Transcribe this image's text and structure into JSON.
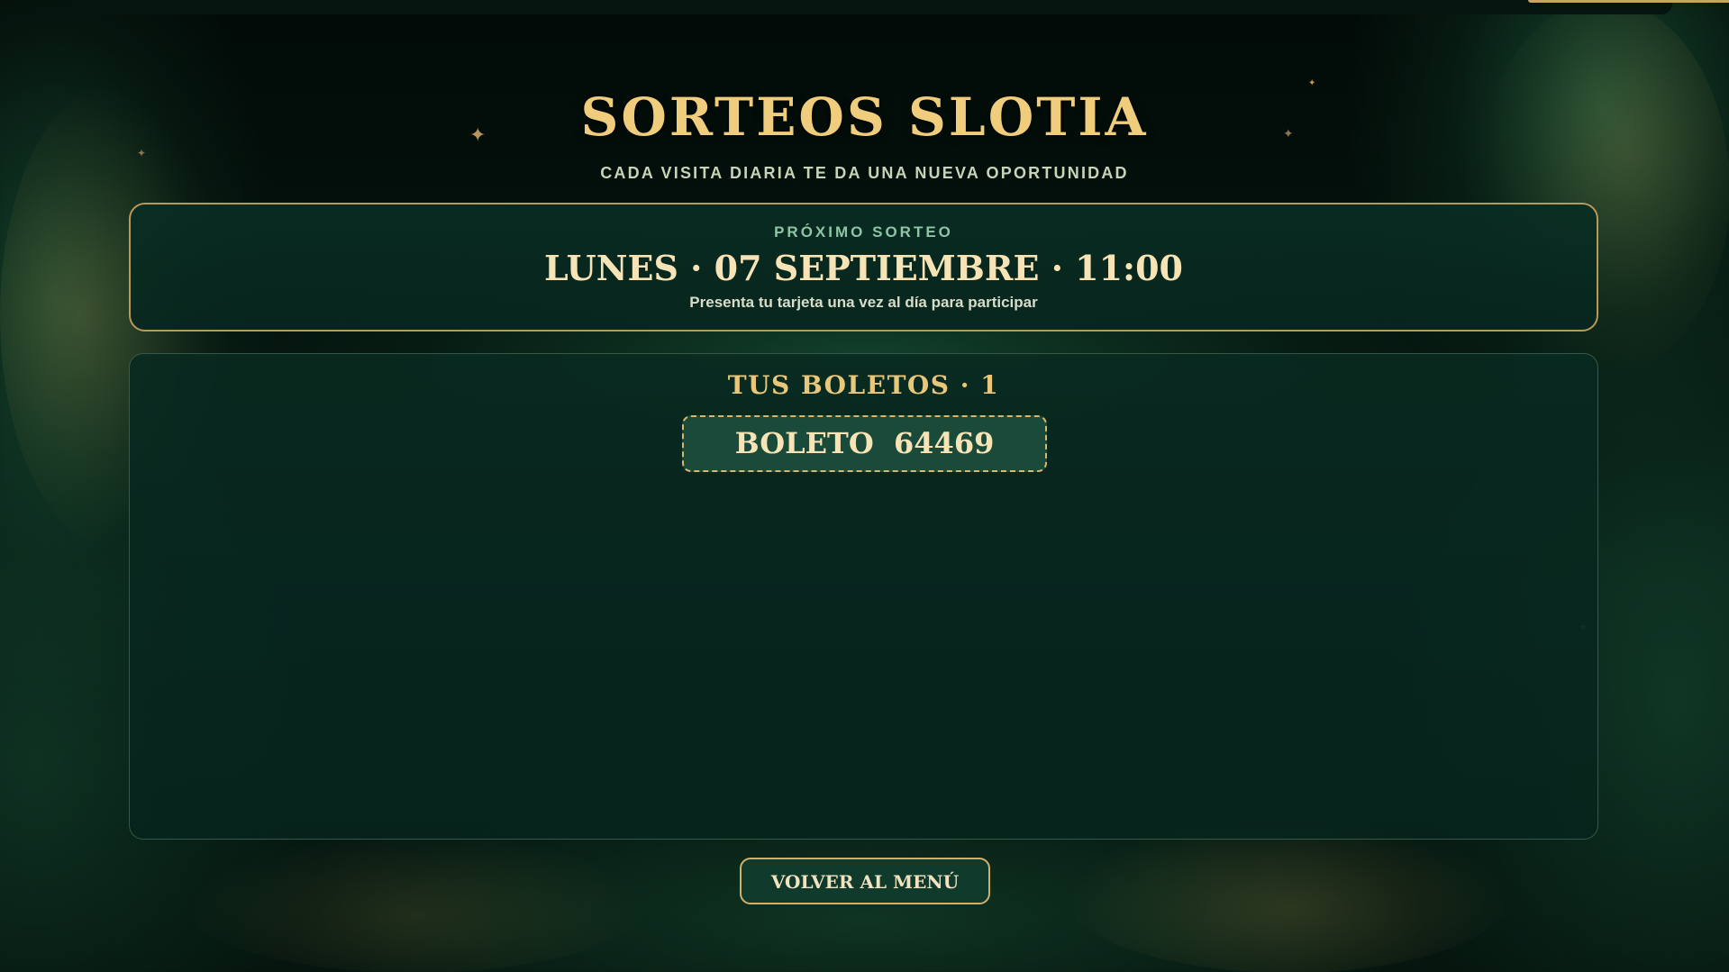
{
  "header": {
    "title": "SORTEOS SLOTIA",
    "subtitle": "CADA VISITA DIARIA TE DA UNA NUEVA OPORTUNIDAD"
  },
  "next_draw": {
    "label": "PRÓXIMO SORTEO",
    "date": "LUNES · 07 SEPTIEMBRE · 11:00",
    "note": "Presenta tu tarjeta una vez al día para participar"
  },
  "tickets": {
    "heading": "TUS BOLETOS · 1",
    "items": [
      {
        "label": "BOLETO  64469"
      }
    ]
  },
  "actions": {
    "back_label": "VOLVER AL MENÚ"
  },
  "colors": {
    "gold": "#f0cd7c",
    "card_border": "#b7995a",
    "card_background": "#082d23",
    "ticket_background": "#1a4a3a",
    "subtitle_text": "#c8d3b8",
    "label_green": "#8fc4a6"
  },
  "icons": {
    "sparkle": "✦"
  }
}
